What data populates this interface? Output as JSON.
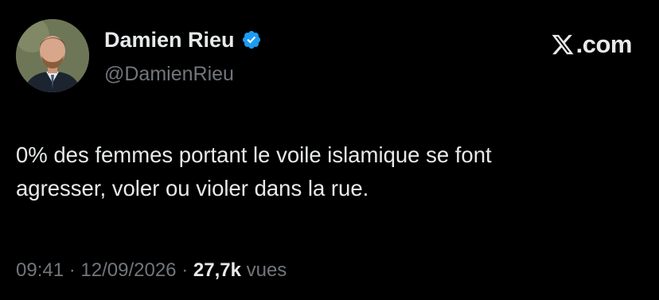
{
  "author": {
    "display_name": "Damien Rieu",
    "handle": "@DamienRieu",
    "verified": true,
    "verified_color": "#1d9bf0"
  },
  "brand": {
    "icon": "x-logo-icon",
    "suffix": ".com"
  },
  "tweet": {
    "lines": [
      "0% des femmes portant le voile islamique se font",
      "agresser, voler ou violer dans la rue."
    ]
  },
  "meta": {
    "time": "09:41",
    "separator": "·",
    "date": "12/09/2026",
    "views_count": "27,7k",
    "views_label": "vues"
  },
  "colors": {
    "background": "#000000",
    "primary_text": "#e7e9ea",
    "secondary_text": "#71767b"
  }
}
